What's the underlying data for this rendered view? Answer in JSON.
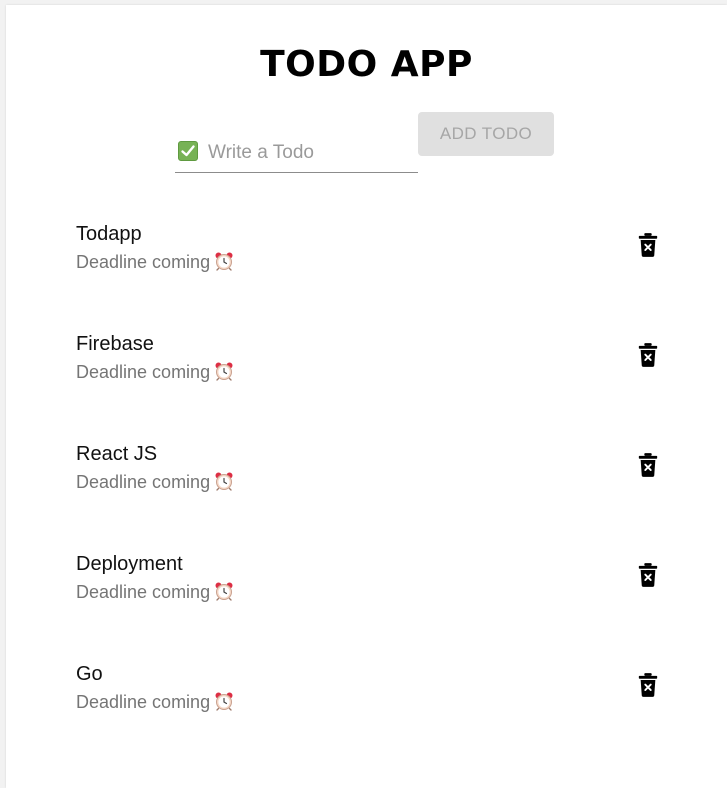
{
  "app": {
    "title": "TODO APP"
  },
  "form": {
    "input_placeholder": "Write a Todo",
    "input_value": "",
    "add_button_label": "ADD TODO",
    "input_icon": "check-mark-box-icon",
    "add_button_enabled": false
  },
  "todos": [
    {
      "text": "Todapp",
      "subtitle": "Deadline coming",
      "status_icon": "alarm-clock-icon",
      "action_icon": "delete-icon"
    },
    {
      "text": "Firebase",
      "subtitle": "Deadline coming",
      "status_icon": "alarm-clock-icon",
      "action_icon": "delete-icon"
    },
    {
      "text": "React JS",
      "subtitle": "Deadline coming",
      "status_icon": "alarm-clock-icon",
      "action_icon": "delete-icon"
    },
    {
      "text": "Deployment",
      "subtitle": "Deadline coming",
      "status_icon": "alarm-clock-icon",
      "action_icon": "delete-icon"
    },
    {
      "text": "Go",
      "subtitle": "Deadline coming",
      "status_icon": "alarm-clock-icon",
      "action_icon": "delete-icon"
    }
  ],
  "colors": {
    "background": "#ffffff",
    "page": "#f2f2f2",
    "title": "#000000",
    "todo_text": "#111111",
    "subtitle": "#757575",
    "button_disabled_bg": "#e0e0e0",
    "button_disabled_text": "#a6a6a6",
    "check_green": "#77b255",
    "alarm_red": "#dd2e44"
  }
}
